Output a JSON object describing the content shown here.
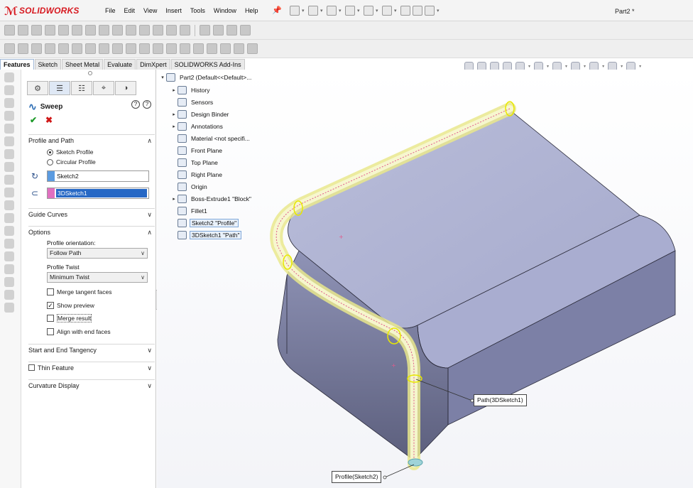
{
  "app": {
    "logo_text": "SOLIDWORKS",
    "document_title": "Part2 *",
    "menus": [
      "File",
      "Edit",
      "View",
      "Insert",
      "Tools",
      "Window",
      "Help"
    ]
  },
  "command_tabs": [
    "Features",
    "Sketch",
    "Sheet Metal",
    "Evaluate",
    "DimXpert",
    "SOLIDWORKS Add-Ins"
  ],
  "property_manager": {
    "title": "Sweep",
    "help_glyph": "?",
    "ok_glyph": "✔",
    "cancel_glyph": "✖",
    "sections": {
      "profile_and_path": {
        "label": "Profile and Path",
        "radio_sketch_profile": "Sketch Profile",
        "radio_circular_profile": "Circular Profile",
        "profile_value": "Sketch2",
        "path_value": "3DSketch1",
        "profile_color": "#5b9be0",
        "path_color": "#e070c0"
      },
      "guide_curves": {
        "label": "Guide Curves"
      },
      "options": {
        "label": "Options",
        "orientation_label": "Profile orientation:",
        "orientation_value": "Follow Path",
        "twist_label": "Profile Twist",
        "twist_value": "Minimum Twist",
        "merge_tangent": "Merge tangent faces",
        "show_preview": "Show preview",
        "merge_result": "Merge result",
        "align_end": "Align with end faces"
      },
      "start_end": {
        "label": "Start and End Tangency"
      },
      "thin_feature": {
        "label": "Thin Feature"
      },
      "curvature": {
        "label": "Curvature Display"
      }
    }
  },
  "feature_tree": {
    "root": "Part2  (Default<<Default>...",
    "items": [
      {
        "label": "History",
        "expandable": true
      },
      {
        "label": "Sensors",
        "expandable": false
      },
      {
        "label": "Design Binder",
        "expandable": true
      },
      {
        "label": "Annotations",
        "expandable": true
      },
      {
        "label": "Material <not specifi...",
        "expandable": false
      },
      {
        "label": "Front Plane",
        "expandable": false
      },
      {
        "label": "Top Plane",
        "expandable": false
      },
      {
        "label": "Right Plane",
        "expandable": false
      },
      {
        "label": "Origin",
        "expandable": false
      },
      {
        "label": "Boss-Extrude1 \"Block\"",
        "expandable": true
      },
      {
        "label": "Fillet1",
        "expandable": false
      },
      {
        "label": "Sketch2 \"Profile\"",
        "expandable": false
      },
      {
        "label": "3DSketch1 \"Path\"",
        "expandable": false
      }
    ]
  },
  "callouts": {
    "path": "Path(3DSketch1)",
    "profile": "Profile(Sketch2)"
  },
  "colors": {
    "accent_red": "#d71920",
    "selection_blue": "#2768c5",
    "model_face": "#9fa3c9",
    "sweep_preview": "#f3f3b0"
  }
}
